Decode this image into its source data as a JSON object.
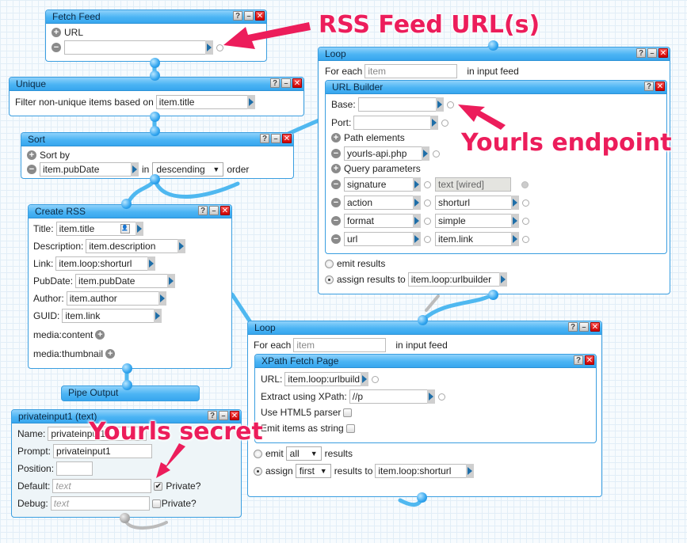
{
  "annotations": {
    "rss_feed": "RSS Feed URL(s)",
    "yourls_endpoint": "Yourls endpoint",
    "yourls_secret": "Yourls secret"
  },
  "fetch_feed": {
    "title": "Fetch Feed",
    "url_label": "URL",
    "url_value": ""
  },
  "unique": {
    "title": "Unique",
    "label": "Filter non-unique items based on",
    "value": "item.title"
  },
  "sort": {
    "title": "Sort",
    "sort_by_label": "Sort by",
    "field_value": "item.pubDate",
    "in_label": "in",
    "order_value": "descending",
    "order_label": "order"
  },
  "create_rss": {
    "title": "Create RSS",
    "fields": [
      {
        "label": "Title:",
        "value": "item.title"
      },
      {
        "label": "Description:",
        "value": "item.description"
      },
      {
        "label": "Link:",
        "value": "item.loop:shorturl"
      },
      {
        "label": "PubDate:",
        "value": "item.pubDate"
      },
      {
        "label": "Author:",
        "value": "item.author"
      },
      {
        "label": "GUID:",
        "value": "item.link"
      }
    ],
    "media_content": "media:content",
    "media_thumbnail": "media:thumbnail"
  },
  "pipe_output": {
    "title": "Pipe Output"
  },
  "private_input": {
    "title": "privateinput1 (text)",
    "name_label": "Name:",
    "name_value": "privateinput1",
    "prompt_label": "Prompt:",
    "prompt_value": "privateinput1",
    "position_label": "Position:",
    "position_value": "",
    "default_label": "Default:",
    "default_placeholder": "text",
    "default_private_label": "Private?",
    "default_private_checked": true,
    "debug_label": "Debug:",
    "debug_placeholder": "text",
    "debug_private_label": "Private?",
    "debug_private_checked": false
  },
  "loop1": {
    "title": "Loop",
    "for_each_label": "For each",
    "for_each_value": "item",
    "in_feed_label": "in input feed",
    "url_builder": {
      "title": "URL Builder",
      "base_label": "Base:",
      "base_value": "",
      "port_label": "Port:",
      "port_value": "",
      "path_label": "Path elements",
      "path_value": "yourls-api.php",
      "query_label": "Query parameters",
      "params": [
        {
          "key": "signature",
          "value": "text [wired]",
          "wired": true
        },
        {
          "key": "action",
          "value": "shorturl",
          "wired": false
        },
        {
          "key": "format",
          "value": "simple",
          "wired": false
        },
        {
          "key": "url",
          "value": "item.link",
          "wired": false
        }
      ]
    },
    "emit_label": "emit results",
    "assign_label": "assign results to",
    "assign_value": "item.loop:urlbuilder",
    "selected_mode": "assign"
  },
  "loop2": {
    "title": "Loop",
    "for_each_label": "For each",
    "for_each_value": "item",
    "in_feed_label": "in input feed",
    "xpath": {
      "title": "XPath Fetch Page",
      "url_label": "URL:",
      "url_value": "item.loop:urlbuild",
      "xpath_label": "Extract using XPath:",
      "xpath_value": "//p",
      "html5_label": "Use HTML5 parser",
      "html5_checked": false,
      "string_label": "Emit items as string",
      "string_checked": false
    },
    "emit_label": "emit",
    "emit_select": "all",
    "emit_results_label": "results",
    "assign_label": "assign",
    "assign_select": "first",
    "assign_results_label": "results to",
    "assign_value": "item.loop:shorturl",
    "selected_mode": "assign"
  },
  "header_buttons": {
    "help": "?",
    "minimize": "–",
    "close": "✕"
  }
}
